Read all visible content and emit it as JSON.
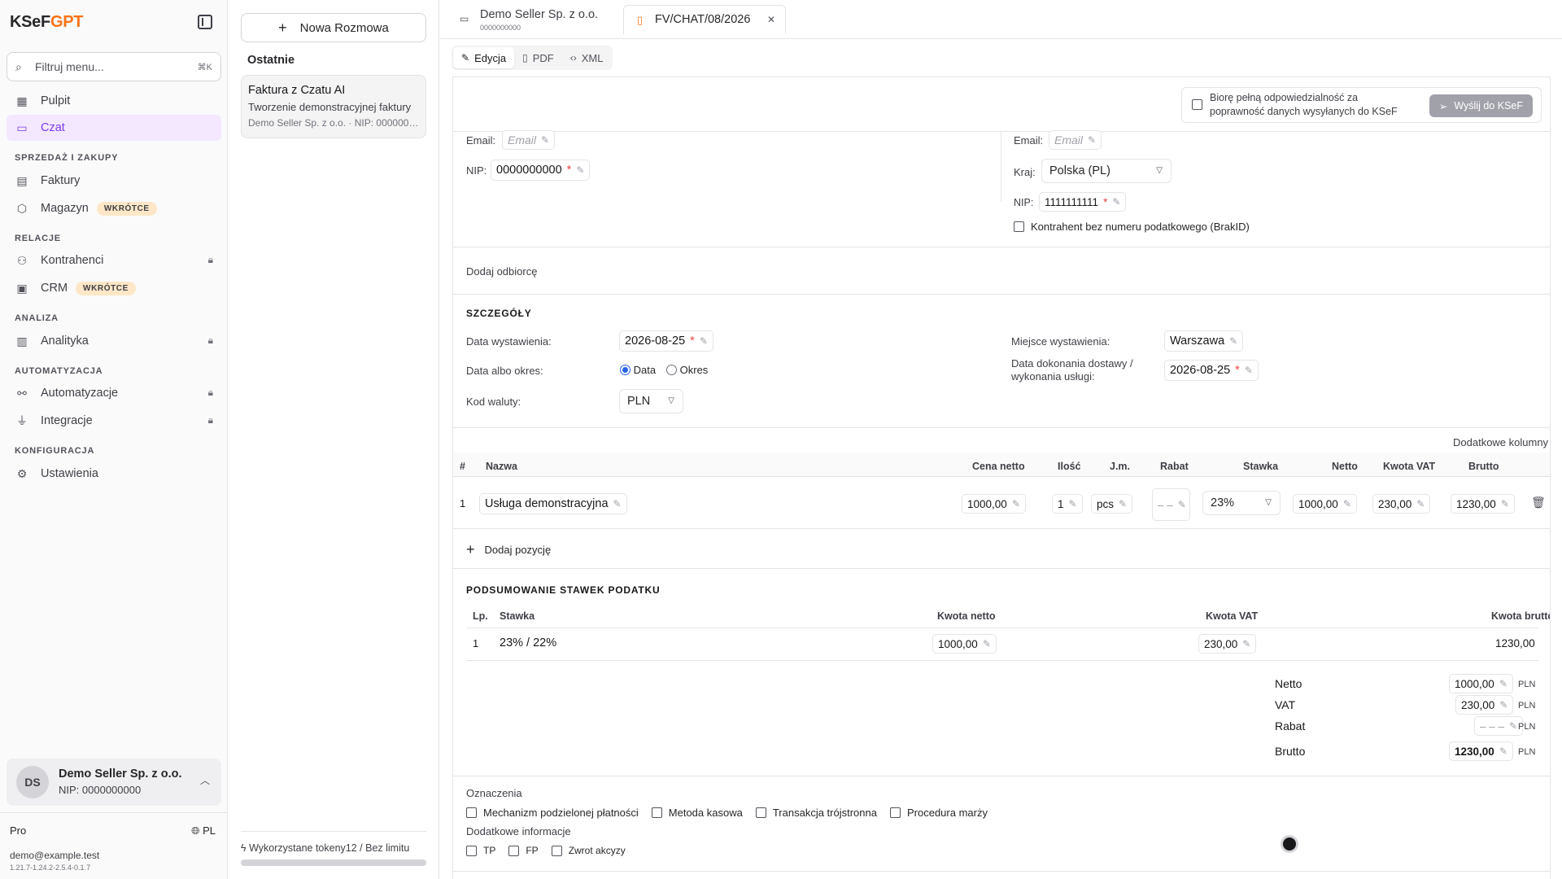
{
  "app": {
    "logo_main": "KSeF",
    "logo_accent": "GPT"
  },
  "sidebar": {
    "filter_placeholder": "Filtruj menu...",
    "filter_shortcut": "⌘K",
    "items": [
      {
        "label": "Pulpit"
      },
      {
        "label": "Czat"
      },
      {
        "label": "Faktury"
      },
      {
        "label": "Magazyn",
        "badge": "WKRÓTCE"
      },
      {
        "label": "Kontrahenci"
      },
      {
        "label": "CRM",
        "badge": "WKRÓTCE"
      },
      {
        "label": "Analityka"
      },
      {
        "label": "Automatyzacje"
      },
      {
        "label": "Integracje"
      },
      {
        "label": "Ustawienia"
      }
    ],
    "sections": [
      "SPRZEDAŻ I ZAKUPY",
      "RELACJE",
      "ANALIZA",
      "AUTOMATYZACJA",
      "KONFIGURACJA"
    ],
    "account": {
      "initials": "DS",
      "name": "Demo Seller Sp. z o.o.",
      "nip": "NIP: 0000000000"
    },
    "plan": "Pro",
    "lang": "PL",
    "email": "demo@example.test",
    "version": "1.21.7-1.24.2-2.5.4-0.1.7"
  },
  "chat": {
    "new_button": "Nowa Rozmowa",
    "recent_heading": "Ostatnie",
    "recent": [
      {
        "title": "Faktura z Czatu AI",
        "desc": "Tworzenie demonstracyjnej faktury",
        "meta": "Demo Seller Sp. z o.o. · NIP: 0000000000"
      }
    ],
    "tokens": "Wykorzystane tokeny12 / Bez limitu"
  },
  "tabs": {
    "first": {
      "name": "Demo Seller Sp. z o.o.",
      "sub": "0000000000"
    },
    "second": {
      "name": "FV/CHAT/08/2026"
    },
    "modes": [
      "Edycja",
      "PDF",
      "XML"
    ]
  },
  "confirm": {
    "text_line1": "Biorę pełną odpowiedzialność za",
    "text_line2": "poprawność danych wysyłanych do KSeF",
    "send": "Wyślij do KSeF"
  },
  "seller": {
    "email_label": "Email:",
    "email_placeholder": "Email",
    "nip_label": "NIP:",
    "nip": "0000000000"
  },
  "buyer": {
    "email_label": "Email:",
    "email_placeholder": "Email",
    "country_label": "Kraj:",
    "country": "Polska (PL)",
    "nip_label": "NIP:",
    "nip": "1111111111",
    "no_tax_id": "Kontrahent bez numeru podatkowego (BrakID)"
  },
  "add_recipient": "Dodaj odbiorcę",
  "details": {
    "heading": "SZCZEGÓŁY",
    "issue_date_label": "Data wystawienia:",
    "issue_date": "2026-08-25",
    "date_or_period_label": "Data albo okres:",
    "opt_date": "Data",
    "opt_period": "Okres",
    "currency_label": "Kod waluty:",
    "currency": "PLN",
    "place_label": "Miejsce wystawienia:",
    "place": "Warszawa",
    "delivery_label_1": "Data dokonania dostawy /",
    "delivery_label_2": "wykonania usługi:",
    "delivery_date": "2026-08-25"
  },
  "items": {
    "extra_columns": "Dodatkowe kolumny",
    "headers": {
      "no": "#",
      "name": "Nazwa",
      "net_price": "Cena netto",
      "qty": "Ilość",
      "unit": "J.m.",
      "discount": "Rabat",
      "rate": "Stawka",
      "net": "Netto",
      "vat": "Kwota VAT",
      "gross": "Brutto"
    },
    "rows": [
      {
        "no": "1",
        "name": "Usługa demonstracyjna",
        "net_price": "1000,00",
        "qty": "1",
        "unit": "pcs",
        "discount": "– –",
        "rate": "23%",
        "net": "1000,00",
        "vat": "230,00",
        "gross": "1230,00"
      }
    ],
    "add_item": "Dodaj pozycję"
  },
  "tax_summary": {
    "heading": "PODSUMOWANIE STAWEK PODATKU",
    "headers": {
      "no": "Lp.",
      "rate": "Stawka",
      "net": "Kwota netto",
      "vat": "Kwota VAT",
      "gross": "Kwota brutto"
    },
    "rows": [
      {
        "no": "1",
        "rate": "23% / 22%",
        "net": "1000,00",
        "vat": "230,00",
        "gross": "1230,00"
      }
    ]
  },
  "totals": {
    "net_label": "Netto",
    "net": "1000,00",
    "vat_label": "VAT",
    "vat": "230,00",
    "discount_label": "Rabat",
    "discount": "– – –",
    "gross_label": "Brutto",
    "gross": "1230,00",
    "currency": "PLN"
  },
  "marks": {
    "heading": "Oznaczenia",
    "options": [
      "Mechanizm podzielonej płatności",
      "Metoda kasowa",
      "Transakcja trójstronna",
      "Procedura marży"
    ],
    "extra_heading": "Dodatkowe informacje",
    "extra_options": [
      "TP",
      "FP",
      "Zwrot akcyzy"
    ]
  }
}
